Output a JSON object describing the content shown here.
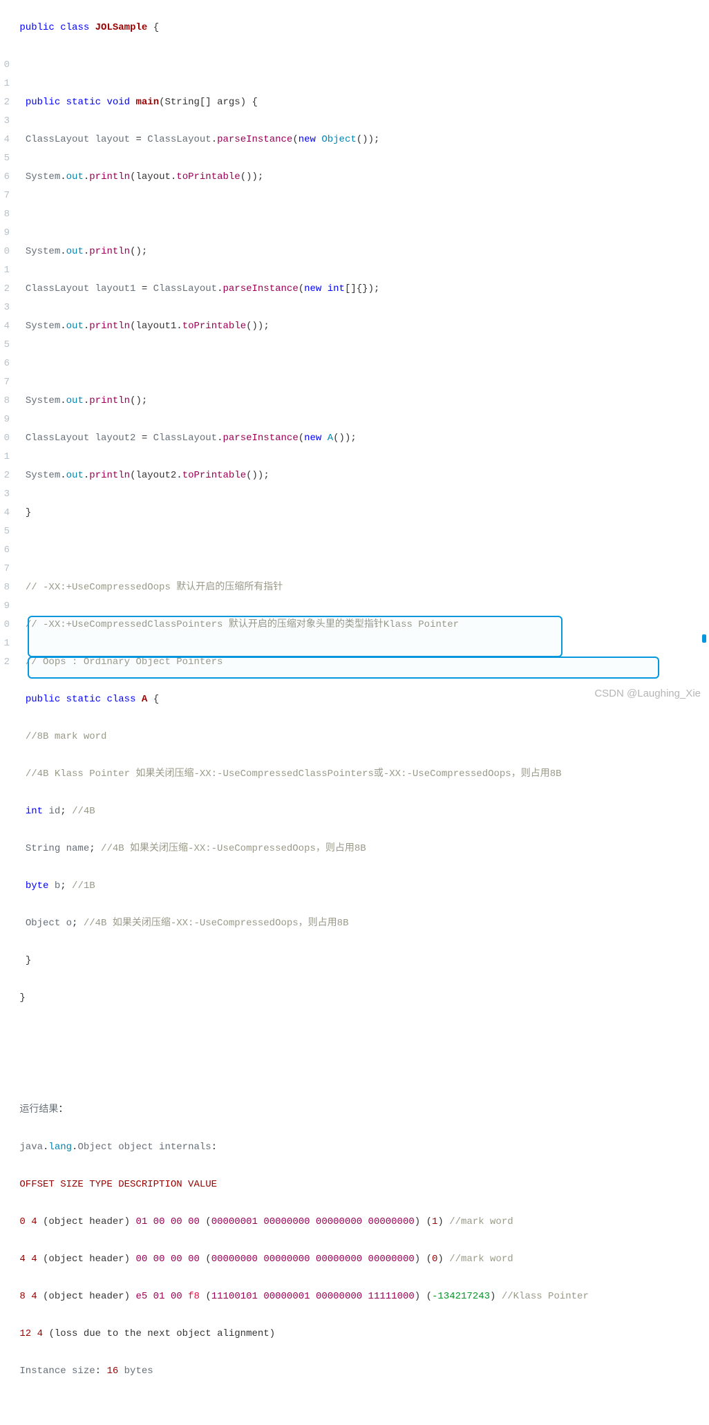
{
  "watermark": "CSDN @Laughing_Xie",
  "gutter": [
    "",
    "",
    "",
    "0",
    "1",
    "2",
    "3",
    "4",
    "5",
    "6",
    "7",
    "8",
    "9",
    "0",
    "1",
    "2",
    "3",
    "4",
    "5",
    "6",
    "7",
    "8",
    "9",
    "0",
    "1",
    "2",
    "3",
    "4",
    "5",
    "6",
    "7",
    "8",
    "9",
    "0",
    "1",
    "2"
  ],
  "code": {
    "l1": {
      "a": "public",
      "b": "class",
      "c": "JOLSample",
      "d": "{"
    },
    "l3": {
      "a": "public",
      "b": "static",
      "c": "void",
      "d": "main",
      "e": "(String[] args)",
      "f": "{"
    },
    "l4": {
      "a": "ClassLayout layout",
      "b": "=",
      "c": "ClassLayout",
      "d": ".",
      "e": "parseInstance",
      "f": "(",
      "g": "new",
      "h": "Object",
      "i": "());"
    },
    "l5": {
      "a": "System",
      "b": ".",
      "c": "out",
      "d": ".",
      "e": "println",
      "f": "(layout.",
      "g": "toPrintable",
      "h": "());"
    },
    "l7": {
      "a": "System",
      "b": ".",
      "c": "out",
      "d": ".",
      "e": "println",
      "f": "();"
    },
    "l8": {
      "a": "ClassLayout layout1",
      "b": "=",
      "c": "ClassLayout",
      "d": ".",
      "e": "parseInstance",
      "f": "(",
      "g": "new",
      "h": "int",
      "i": "[]{});"
    },
    "l9": {
      "a": "System",
      "b": ".",
      "c": "out",
      "d": ".",
      "e": "println",
      "f": "(layout1.",
      "g": "toPrintable",
      "h": "());"
    },
    "l11": {
      "a": "System",
      "b": ".",
      "c": "out",
      "d": ".",
      "e": "println",
      "f": "();"
    },
    "l12": {
      "a": "ClassLayout layout2",
      "b": "=",
      "c": "ClassLayout",
      "d": ".",
      "e": "parseInstance",
      "f": "(",
      "g": "new",
      "h": "A",
      "i": "());"
    },
    "l13": {
      "a": "System",
      "b": ".",
      "c": "out",
      "d": ".",
      "e": "println",
      "f": "(layout2.",
      "g": "toPrintable",
      "h": "());"
    },
    "l14": {
      "a": "}"
    },
    "l16": {
      "a": "// -XX:+UseCompressedOops 默认开启的压缩所有指针"
    },
    "l17": {
      "a": "// -XX:+UseCompressedClassPointers 默认开启的压缩对象头里的类型指针Klass Pointer"
    },
    "l18": {
      "a": "// Oops : Ordinary Object Pointers"
    },
    "l19": {
      "a": "public",
      "b": "static",
      "c": "class",
      "d": "A",
      "e": "{"
    },
    "l20": {
      "a": "//8B mark word"
    },
    "l21": {
      "a": "//4B Klass Pointer 如果关闭压缩-XX:-UseCompressedClassPointers或-XX:-UseCompressedOops，则占用8B"
    },
    "l22": {
      "a": "int",
      "b": "id",
      "c": ";",
      "d": "//4B"
    },
    "l23": {
      "a": "String name",
      "b": ";",
      "c": "//4B 如果关闭压缩-XX:-UseCompressedOops，则占用8B"
    },
    "l24": {
      "a": "byte",
      "b": "b",
      "c": ";",
      "d": "//1B"
    },
    "l25": {
      "a": "Object o",
      "b": ";",
      "c": "//4B 如果关闭压缩-XX:-UseCompressedOops，则占用8B"
    },
    "l26": {
      "a": "}"
    },
    "l27": {
      "a": "}"
    },
    "l30": {
      "a": "运行结果",
      "b": "："
    },
    "l31": {
      "a": "java",
      "b": ".",
      "c": "lang",
      "d": ".",
      "e": "Object object internals",
      "f": ":"
    },
    "l32": {
      "a": "OFFSET SIZE TYPE DESCRIPTION VALUE"
    },
    "l33": {
      "a": "0",
      "b": "4",
      "c": "(object header)",
      "d": "01 00 00 00",
      "e": "(",
      "f": "00000001 00000000 00000000 00000000",
      "g": ")",
      "h": "(",
      "i": "1",
      "j": ")",
      "k": "//mark word"
    },
    "l34": {
      "a": "4",
      "b": "4",
      "c": "(object header)",
      "d": "00 00 00 00",
      "e": "(",
      "f": "00000000 00000000 00000000 00000000",
      "g": ")",
      "h": "(",
      "i": "0",
      "j": ")",
      "k": "//mark word"
    },
    "l35": {
      "a": "8",
      "b": "4",
      "c": "(object header)",
      "d1": "e5 01 00",
      "d2": "f8",
      "e": "(",
      "f": "11100101 00000001 00000000 11111000",
      "g": ")",
      "h": "(",
      "i": "-134217243",
      "j": ")",
      "k": "//Klass Pointer"
    },
    "l36": {
      "a": "12",
      "b": "4",
      "c": "(loss due to the next object alignment)"
    },
    "l37": {
      "a": "Instance size",
      "b": ":",
      "c": "16",
      "d": "bytes"
    }
  }
}
